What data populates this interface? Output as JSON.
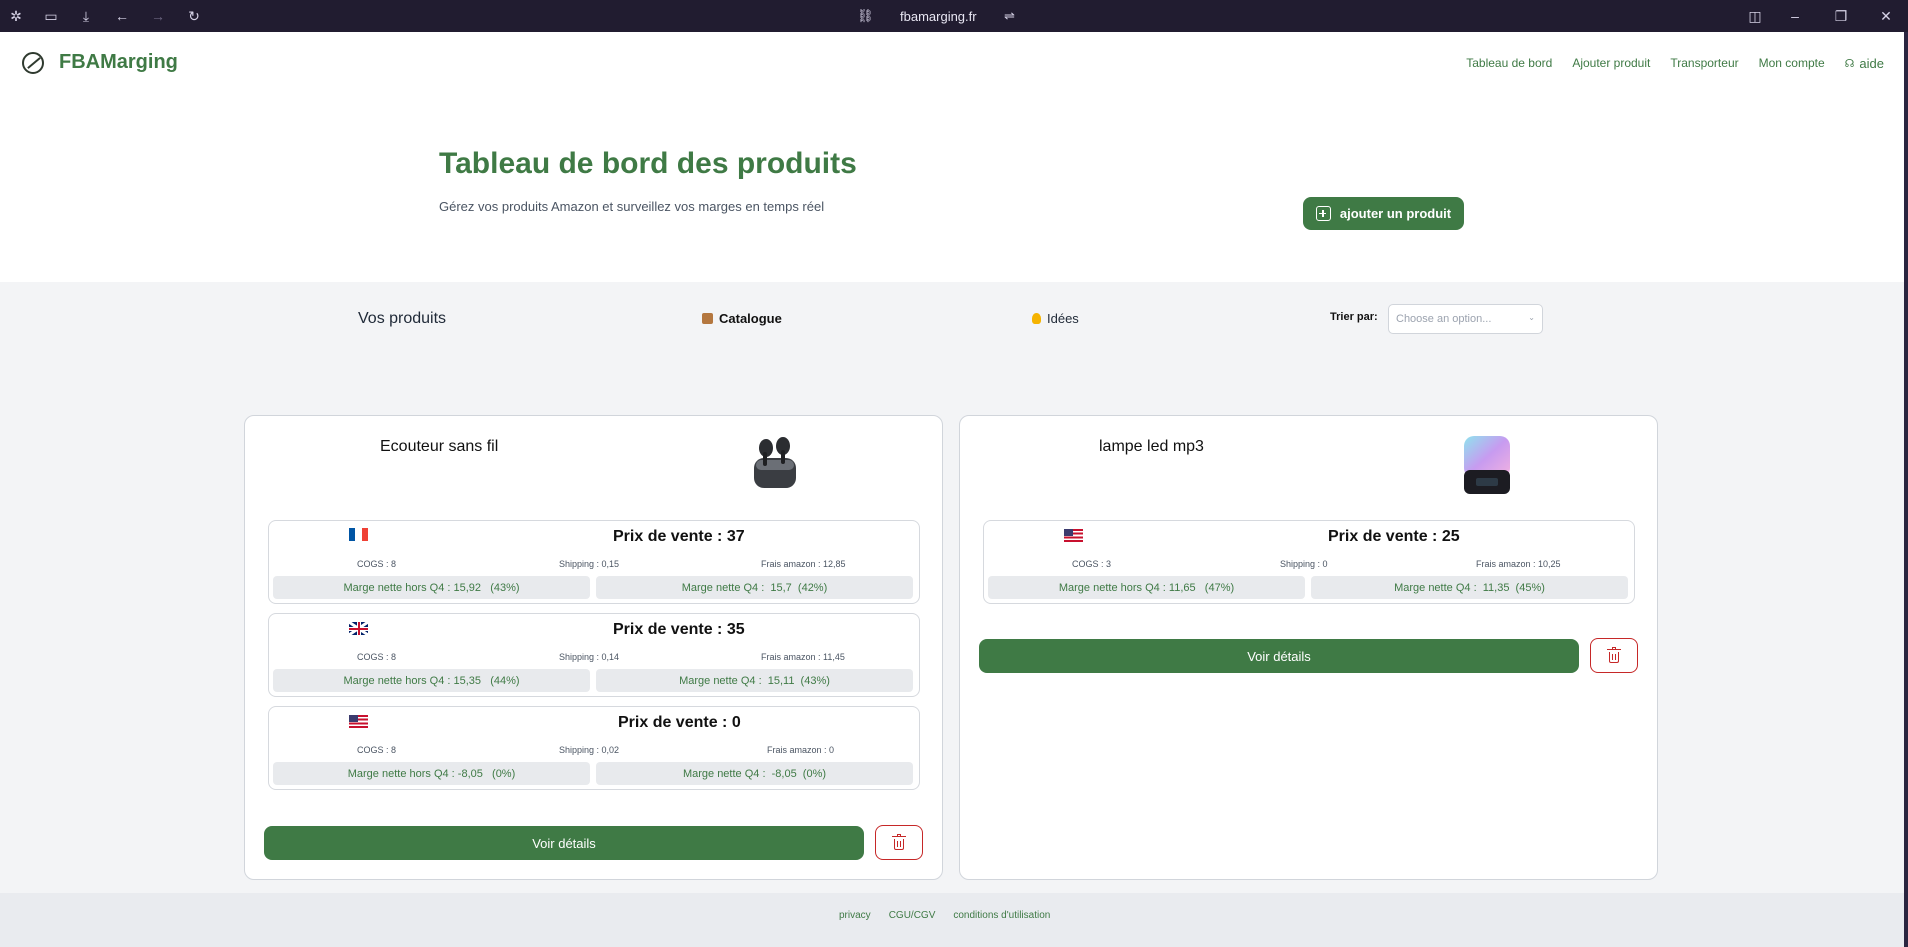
{
  "browser": {
    "url": "fbamarging.fr",
    "icons": [
      "app-icon",
      "sidebar-icon",
      "download-icon",
      "back-icon",
      "forward-icon",
      "reload-icon",
      "link-icon",
      "tune-icon",
      "split-view-icon",
      "minimize-icon",
      "restore-icon",
      "close-icon"
    ]
  },
  "nav": {
    "brand": "FBAMarging",
    "links": [
      "Tableau de bord",
      "Ajouter produit",
      "Transporteur",
      "Mon compte"
    ],
    "help": "aide"
  },
  "hero": {
    "title": "Tableau de bord des produits",
    "subtitle": "Gérez vos produits Amazon et surveillez vos marges en temps réel",
    "add_button": "ajouter un produit"
  },
  "filters": {
    "title": "Vos produits",
    "tab_catalogue": "Catalogue",
    "tab_ideas": "Idées",
    "sort_label": "Trier par:",
    "sort_placeholder": "Choose an option..."
  },
  "products": [
    {
      "name": "Ecouteur sans fil",
      "markets": [
        {
          "flag": "fr",
          "price": "Prix de vente : 37",
          "cogs": "COGS : 8",
          "shipping": "Shipping : 0,15",
          "fees": "Frais amazon : 12,85",
          "margin_non_q4": "Marge nette hors Q4 : 15,92   (43%)",
          "margin_q4": "Marge nette Q4 :  15,7  (42%)"
        },
        {
          "flag": "uk",
          "price": "Prix de vente : 35",
          "cogs": "COGS : 8",
          "shipping": "Shipping : 0,14",
          "fees": "Frais amazon : 11,45",
          "margin_non_q4": "Marge nette hors Q4 : 15,35   (44%)",
          "margin_q4": "Marge nette Q4 :  15,11  (43%)"
        },
        {
          "flag": "us",
          "price": "Prix de vente : 0",
          "cogs": "COGS : 8",
          "shipping": "Shipping : 0,02",
          "fees": "Frais amazon : 0",
          "margin_non_q4": "Marge nette hors Q4 : -8,05   (0%)",
          "margin_q4": "Marge nette Q4 :  -8,05  (0%)"
        }
      ],
      "details_button": "Voir détails"
    },
    {
      "name": "lampe led mp3",
      "markets": [
        {
          "flag": "us",
          "price": "Prix de vente : 25",
          "cogs": "COGS : 3",
          "shipping": "Shipping : 0",
          "fees": "Frais amazon : 10,25",
          "margin_non_q4": "Marge nette hors Q4 : 11,65   (47%)",
          "margin_q4": "Marge nette Q4 :  11,35  (45%)"
        }
      ],
      "details_button": "Voir détails"
    }
  ],
  "footer": {
    "links": [
      "privacy",
      "CGU/CGV",
      "conditions d'utilisation"
    ]
  },
  "colors": {
    "brand_green": "#3f7a45",
    "danger_red": "#c62828",
    "section_bg": "#f3f4f6",
    "chrome_bg": "#211c30"
  }
}
